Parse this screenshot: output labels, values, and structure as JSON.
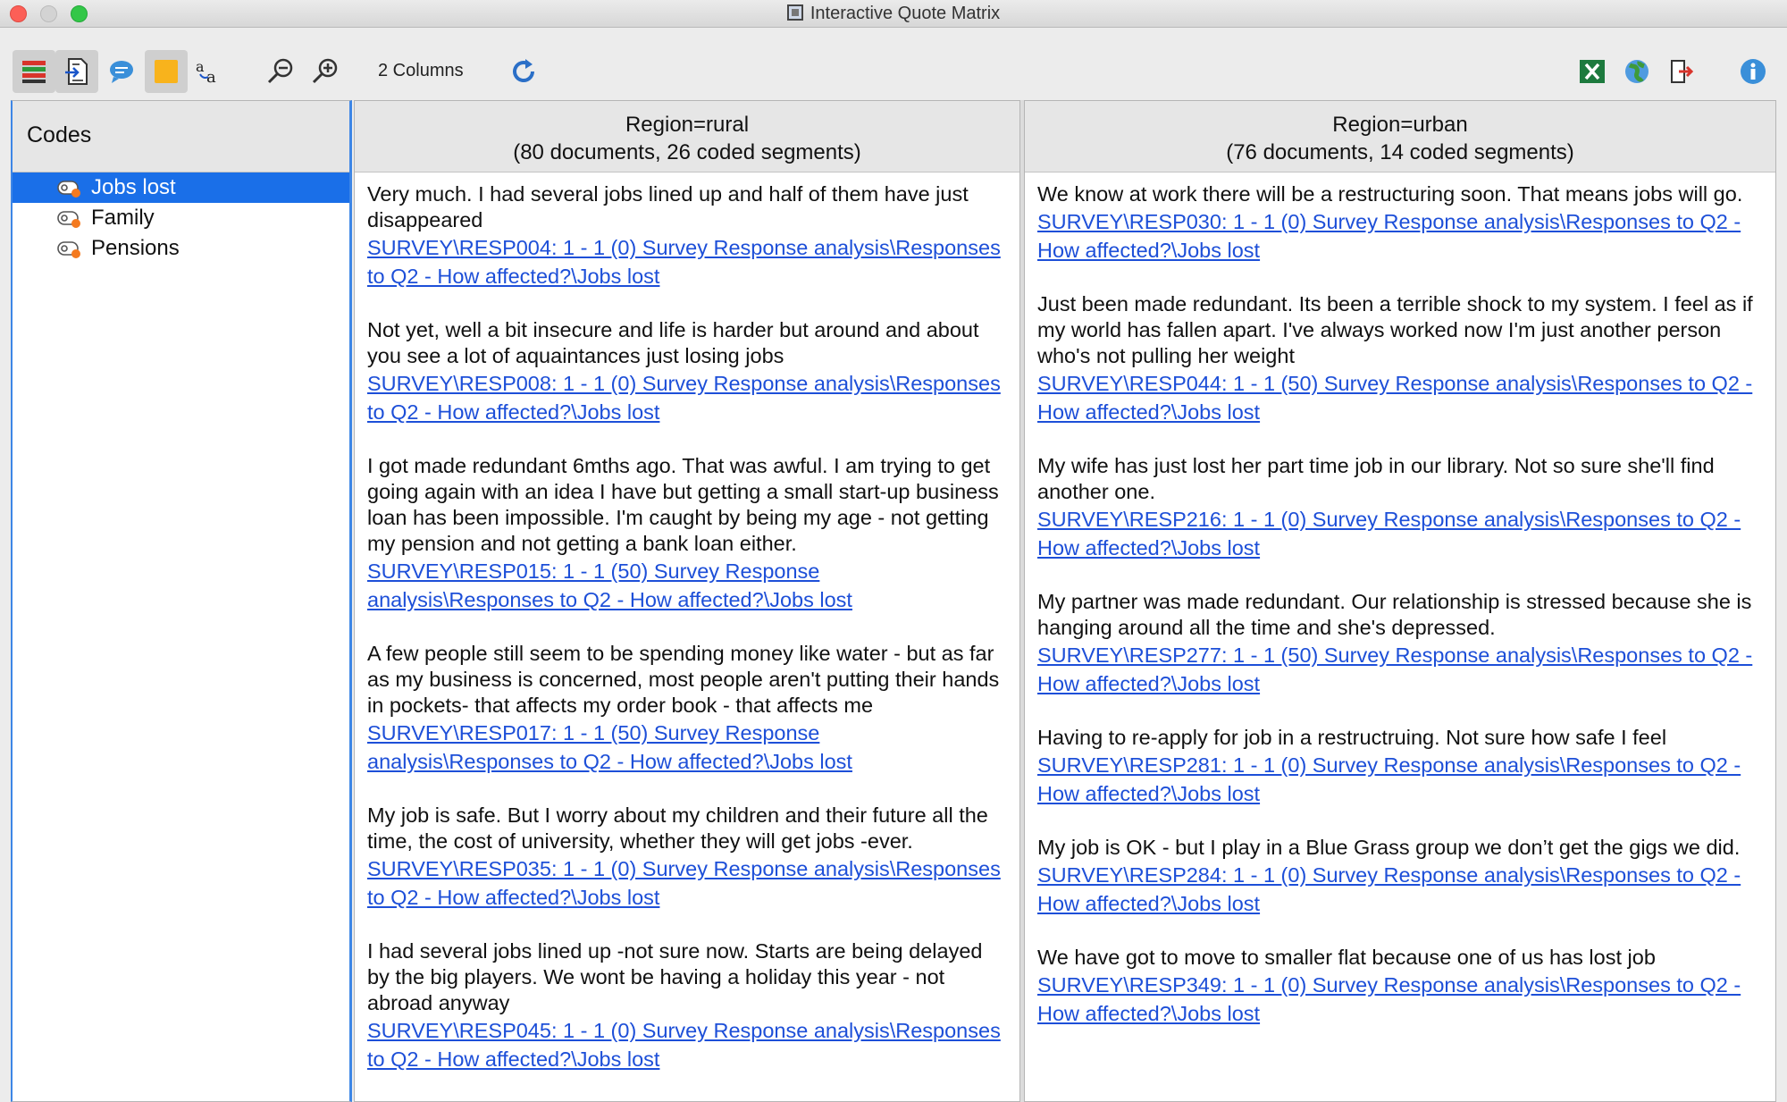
{
  "window": {
    "title": "Interactive Quote Matrix"
  },
  "toolbar": {
    "column_count_label": "2 Columns",
    "icons": [
      "code-tree-icon",
      "export-document-icon",
      "comment-bubble-icon",
      "memo-icon",
      "text-size-icon",
      "zoom-out-icon",
      "zoom-in-icon",
      "refresh-icon",
      "excel-icon",
      "web-globe-icon",
      "exit-icon",
      "info-icon"
    ]
  },
  "codes": {
    "header": "Codes",
    "items": [
      {
        "label": "Jobs lost",
        "selected": true
      },
      {
        "label": "Family",
        "selected": false
      },
      {
        "label": "Pensions",
        "selected": false
      }
    ]
  },
  "columns": [
    {
      "header_line1": "Region=rural",
      "header_line2": "(80 documents, 26 coded segments)",
      "segments": [
        {
          "text": "Very much. I had several jobs lined up and half of them have just disappeared",
          "source": "SURVEY\\RESP004: 1 - 1  (0) Survey Response analysis\\Responses to Q2 - How affected?\\Jobs lost"
        },
        {
          "text": "Not yet, well a bit insecure and life is harder but around and about you see a lot of aquaintances just losing jobs",
          "source": "SURVEY\\RESP008: 1 - 1  (0) Survey Response analysis\\Responses to Q2 - How affected?\\Jobs lost"
        },
        {
          "text": "I got made redundant 6mths ago. That was awful.  I am trying to get going again with an idea I have but getting a small start-up business loan has been impossible. I'm caught by being my age - not getting my pension and not getting a bank loan either.",
          "source": "SURVEY\\RESP015: 1 - 1  (50) Survey Response analysis\\Responses to Q2 - How affected?\\Jobs lost"
        },
        {
          "text": "A few people  still seem to be spending money like water - but as far as my business is concerned, most people aren't putting their hands in pockets- that affects my order book - that affects me",
          "source": "SURVEY\\RESP017: 1 - 1  (50) Survey Response analysis\\Responses to Q2 - How affected?\\Jobs lost"
        },
        {
          "text": "My job is safe. But I worry about my children and their future all the time, the cost of university, whether they will get jobs -ever.",
          "source": "SURVEY\\RESP035: 1 - 1  (0) Survey Response analysis\\Responses to Q2 - How affected?\\Jobs lost"
        },
        {
          "text": "I had several jobs lined up  -not sure now. Starts are being delayed by the big players. We wont be having a holiday this year - not abroad anyway",
          "source": "SURVEY\\RESP045: 1 - 1  (0) Survey Response analysis\\Responses to Q2 - How affected?\\Jobs lost"
        }
      ]
    },
    {
      "header_line1": "Region=urban",
      "header_line2": "(76 documents, 14 coded segments)",
      "segments": [
        {
          "text": "We know at work there will be a restructuring soon. That means jobs will go.",
          "source": "SURVEY\\RESP030: 1 - 1  (0) Survey Response analysis\\Responses to Q2 - How affected?\\Jobs lost"
        },
        {
          "text": "Just been made redundant. Its been a terrible shock to my system.  I feel as if my world has fallen apart. I've always worked now I'm just another person  who's not pulling her weight",
          "source": "SURVEY\\RESP044: 1 - 1  (50) Survey Response analysis\\Responses to Q2 - How affected?\\Jobs lost"
        },
        {
          "text": "My wife has just lost her part time job in our library.   Not so sure she'll find another one.",
          "source": "SURVEY\\RESP216: 1 - 1  (0) Survey Response analysis\\Responses to Q2 - How affected?\\Jobs lost"
        },
        {
          "text": "My partner was made redundant. Our relationship is stressed  because she is hanging around all the time and she's depressed.",
          "source": "SURVEY\\RESP277: 1 - 1  (50) Survey Response analysis\\Responses to Q2 - How affected?\\Jobs lost"
        },
        {
          "text": "Having to re-apply for job in a restructruing. Not sure how safe I feel",
          "source": "SURVEY\\RESP281: 1 - 1  (0) Survey Response analysis\\Responses to Q2 - How affected?\\Jobs lost"
        },
        {
          "text": "My job is OK - but I play in a Blue Grass group we don’t get the gigs we did.",
          "source": "SURVEY\\RESP284: 1 - 1  (0) Survey Response analysis\\Responses to Q2 - How affected?\\Jobs lost"
        },
        {
          "text": "We have got to move to smaller flat because one of us has lost job",
          "source": "SURVEY\\RESP349: 1 - 1  (0) Survey Response analysis\\Responses to Q2 - How affected?\\Jobs lost"
        }
      ]
    }
  ],
  "colors": {
    "selection": "#1a6fe8",
    "link": "#1d4fd8",
    "code_dot": "#f47a1f"
  }
}
